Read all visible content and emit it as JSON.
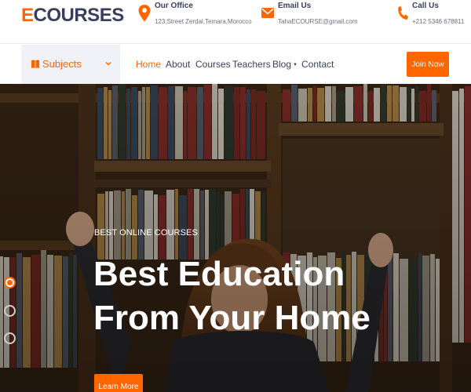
{
  "brand": {
    "accent_letter": "E",
    "rest": "COURSES"
  },
  "contacts": [
    {
      "title": "Our Office",
      "value": "123,Street Zerdal,Temara,Morocco",
      "icon": "map-pin-icon"
    },
    {
      "title": "Email Us",
      "value": "TahaECOURSE@gmail.com",
      "icon": "envelope-icon"
    },
    {
      "title": "Call Us",
      "value": "+212 5346 678811",
      "icon": "phone-icon"
    }
  ],
  "nav": {
    "subjects_label": "Subjects",
    "links": [
      "Home",
      "About",
      "Courses",
      "Teachers",
      "Blog",
      "Contact"
    ],
    "active": "Home",
    "join_label": "Join Now"
  },
  "hero": {
    "kicker": "BEST ONLINE COURSES",
    "title": "Best Education From Your Home",
    "button_label": "Learn More",
    "slides": 3,
    "active_slide": 1
  },
  "colors": {
    "accent": "#ff6600",
    "dark": "#3a3e5c",
    "subjects_bg": "#f0f2f7"
  }
}
